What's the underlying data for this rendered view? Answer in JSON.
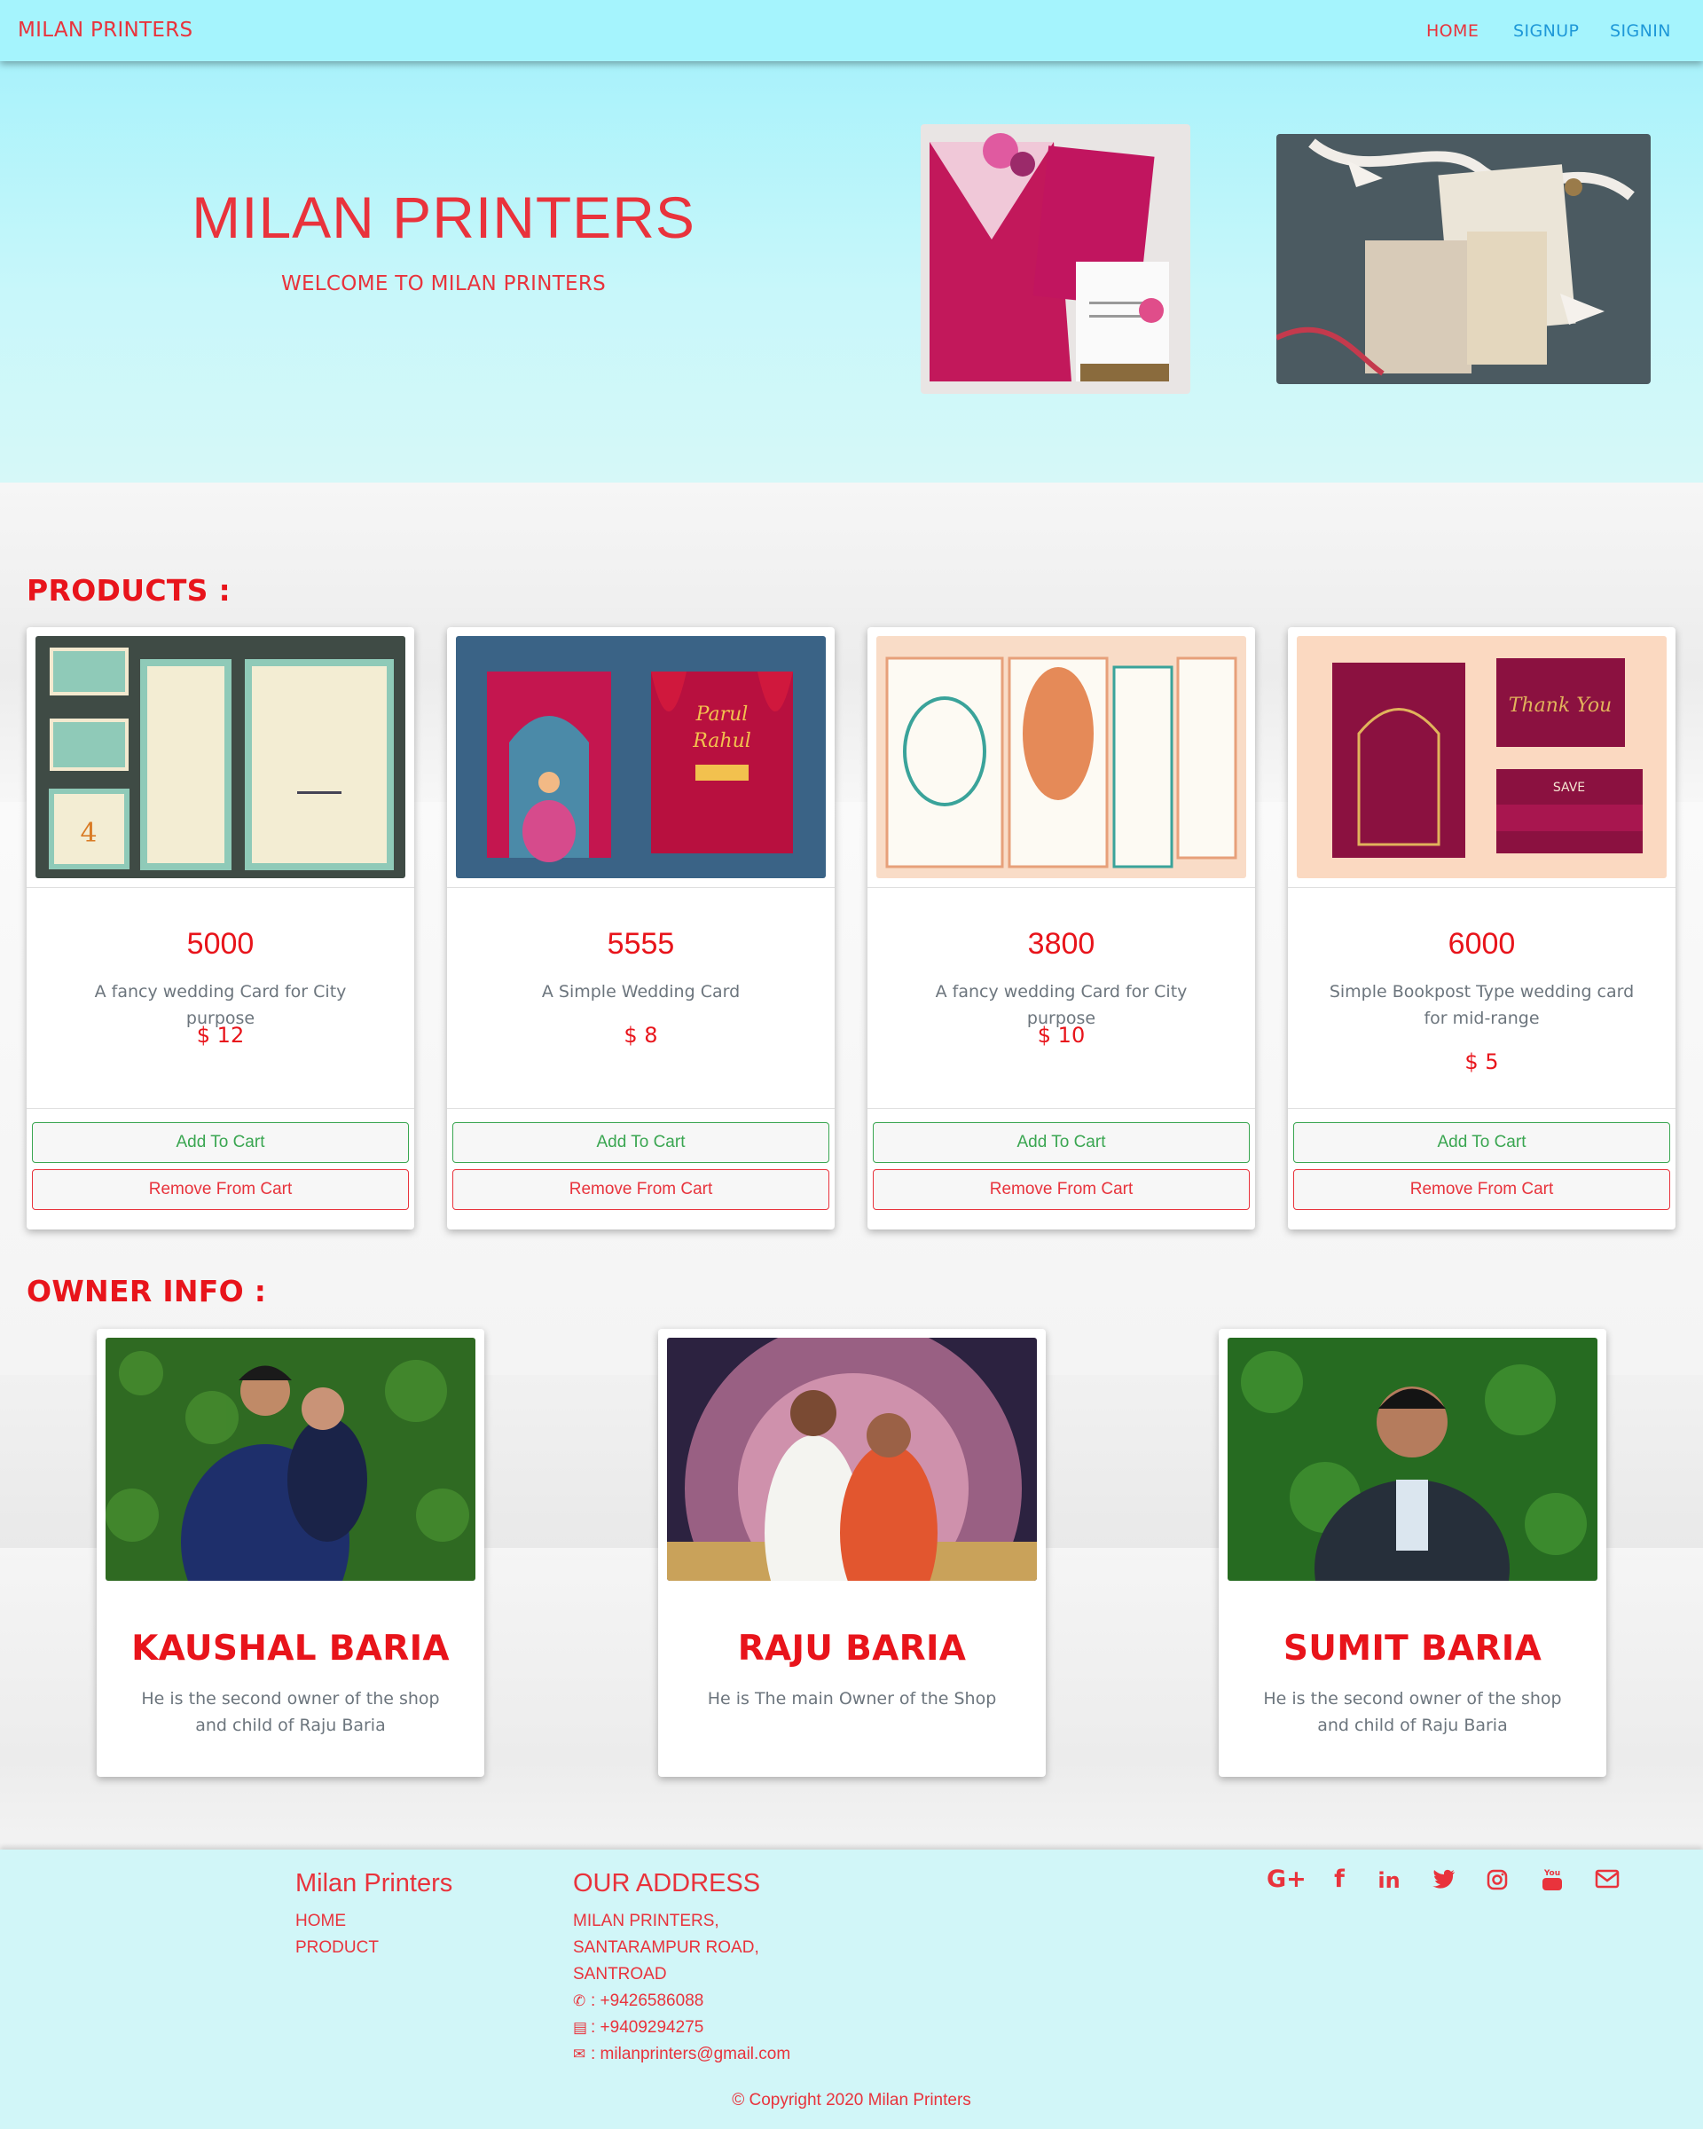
{
  "navbar": {
    "brand": "MILAN PRINTERS",
    "links": [
      "HOME",
      "SIGNUP",
      "SIGNIN"
    ],
    "active_link": "HOME",
    "colors": {
      "background": "#a5f4fd",
      "brand": "#e9333c",
      "link": "#1e98d8"
    }
  },
  "hero": {
    "title": "MILAN PRINTERS",
    "subtitle": "WELCOME TO MILAN PRINTERS"
  },
  "products": {
    "title": "PRODUCTS :",
    "items": [
      {
        "code": "5000",
        "description": "A fancy wedding Card for City purpose",
        "price": "$ 12",
        "add_label": "Add To Cart",
        "remove_label": "Remove From Cart"
      },
      {
        "code": "5555",
        "description": "A Simple Wedding Card",
        "price": "$ 8",
        "add_label": "Add To Cart",
        "remove_label": "Remove From Cart"
      },
      {
        "code": "3800",
        "description": "A fancy wedding Card for City purpose",
        "price": "$ 10",
        "add_label": "Add To Cart",
        "remove_label": "Remove From Cart"
      },
      {
        "code": "6000",
        "description": "Simple Bookpost Type wedding card for mid-range",
        "price": "$ 5",
        "add_label": "Add To Cart",
        "remove_label": "Remove From Cart"
      }
    ]
  },
  "owners": {
    "title": "OWNER INFO :",
    "items": [
      {
        "name": "KAUSHAL BARIA",
        "description": "He is the second owner of the shop and child of Raju Baria"
      },
      {
        "name": "RAJU BARIA",
        "description": "He is The main Owner of the Shop"
      },
      {
        "name": "SUMIT BARIA",
        "description": "He is the second owner of the shop and child of Raju Baria"
      }
    ]
  },
  "footer": {
    "brand_title": "Milan Printers",
    "links": [
      "HOME",
      "PRODUCT"
    ],
    "address_title": "OUR ADDRESS",
    "address_lines": [
      "MILAN PRINTERS,",
      "SANTARAMPUR ROAD,",
      "SANTROAD"
    ],
    "phone": ": +9426586088",
    "fax": ": +9409294275",
    "email": ": milanprinters@gmail.com",
    "social_icons": [
      "google-plus-icon",
      "facebook-icon",
      "linkedin-icon",
      "twitter-icon",
      "instagram-icon",
      "youtube-icon",
      "envelope-icon"
    ],
    "copyright": "© Copyright 2020 Milan Printers",
    "colors": {
      "background": "#d1f6f8",
      "text": "#e9333c"
    }
  }
}
